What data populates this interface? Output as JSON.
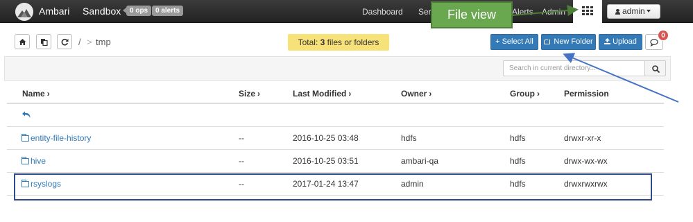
{
  "navbar": {
    "brand": "Ambari",
    "cluster": "Sandbox",
    "ops_badge": "0 ops",
    "alerts_badge": "0 alerts",
    "links": [
      "Dashboard",
      "Services",
      "Alerts",
      "Admin"
    ],
    "user": "admin"
  },
  "callout": {
    "text": "File view"
  },
  "toolbar": {
    "breadcrumb_root": "/",
    "breadcrumb_sep": ">",
    "breadcrumb_current": "tmp",
    "total_prefix": "Total: ",
    "total_count": "3",
    "total_suffix": " files or folders",
    "select_all": "Select All",
    "new_folder": "New Folder",
    "upload": "Upload",
    "notifications": "0"
  },
  "search": {
    "placeholder": "Search in current directory..."
  },
  "table": {
    "headers": {
      "name": "Name",
      "size": "Size",
      "modified": "Last Modified",
      "owner": "Owner",
      "group": "Group",
      "permission": "Permission"
    },
    "rows": [
      {
        "name": "entity-file-history",
        "size": "--",
        "modified": "2016-10-25 03:48",
        "owner": "hdfs",
        "group": "hdfs",
        "permission": "drwxr-xr-x"
      },
      {
        "name": "hive",
        "size": "--",
        "modified": "2016-10-25 03:51",
        "owner": "ambari-qa",
        "group": "hdfs",
        "permission": "drwx-wx-wx"
      },
      {
        "name": "rsyslogs",
        "size": "--",
        "modified": "2017-01-24 13:47",
        "owner": "admin",
        "group": "hdfs",
        "permission": "drwxrwxrwx"
      }
    ]
  },
  "colors": {
    "primary": "#337ab7",
    "callout": "#6aa84f",
    "highlight": "#2c4a8c",
    "total_bg": "#f7e27a",
    "badge_red": "#d9534f"
  },
  "icons": [
    "ambari-logo-icon",
    "grid-icon",
    "user-icon",
    "home-icon",
    "copy-icon",
    "refresh-icon",
    "plus-icon",
    "folder-icon",
    "upload-icon",
    "comment-icon",
    "search-icon",
    "back-arrow-icon"
  ]
}
